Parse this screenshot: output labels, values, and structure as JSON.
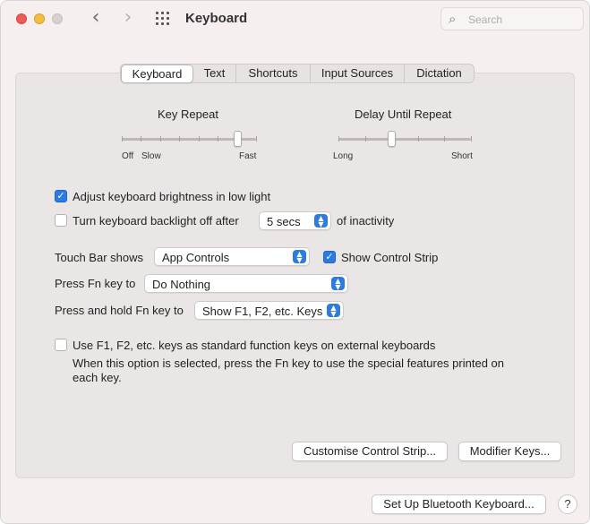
{
  "window": {
    "title": "Keyboard"
  },
  "toolbar": {
    "back_glyph": "‹",
    "forward_glyph": "›",
    "grid_icon": "grid-icon"
  },
  "search": {
    "placeholder": "Search"
  },
  "tabs": [
    {
      "label": "Keyboard",
      "active": true
    },
    {
      "label": "Text",
      "active": false
    },
    {
      "label": "Shortcuts",
      "active": false
    },
    {
      "label": "Input Sources",
      "active": false
    },
    {
      "label": "Dictation",
      "active": false
    }
  ],
  "key_repeat": {
    "title": "Key Repeat",
    "labels": [
      "Off",
      "Slow",
      "Fast"
    ],
    "ticks": 8,
    "value": 0.86
  },
  "delay_until_repeat": {
    "title": "Delay Until Repeat",
    "labels": [
      "Long",
      "Short"
    ],
    "ticks": 6,
    "value": 0.4
  },
  "options": {
    "brightness": {
      "label": "Adjust keyboard brightness in low light",
      "checked": true
    },
    "backlight": {
      "label": "Turn keyboard backlight off after",
      "checked": false,
      "value": "5 secs",
      "suffix": "of inactivity"
    }
  },
  "touch_bar": {
    "label": "Touch Bar shows",
    "value": "App Controls",
    "control_strip": {
      "label": "Show Control Strip",
      "checked": true
    }
  },
  "fn_key": {
    "label": "Press Fn key to",
    "value": "Do Nothing"
  },
  "hold_fn_key": {
    "label": "Press and hold Fn key to",
    "value": "Show F1, F2, etc. Keys"
  },
  "function_keys": {
    "label": "Use F1, F2, etc. keys as standard function keys on external keyboards",
    "checked": false,
    "description_line1": "When this option is selected, press the Fn key to use the special features printed on",
    "description_line2": "each key."
  },
  "buttons": {
    "customise": "Customise Control Strip...",
    "modifier": "Modifier Keys...",
    "bluetooth": "Set Up Bluetooth Keyboard...",
    "help": "?"
  },
  "colors": {
    "accent": "#2b7be6",
    "close": "#ee5d55",
    "minimize": "#f6bd3a"
  }
}
